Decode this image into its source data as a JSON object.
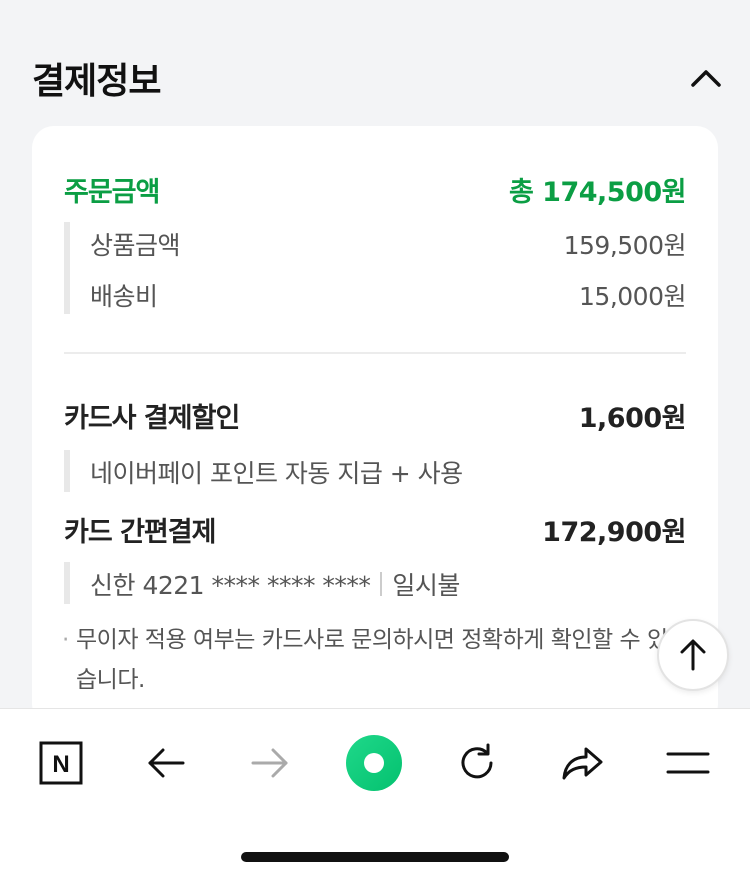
{
  "section": {
    "title": "결제정보"
  },
  "order": {
    "label": "주문금액",
    "total": "총 174,500원",
    "items": [
      {
        "label": "상품금액",
        "value": "159,500원"
      },
      {
        "label": "배송비",
        "value": "15,000원"
      }
    ]
  },
  "discount": {
    "label": "카드사 결제할인",
    "value": "1,600원",
    "detail": "네이버페이 포인트 자동 지급 + 사용"
  },
  "payment": {
    "label": "카드 간편결제",
    "value": "172,900원",
    "card": "신한 4221 **** **** ****",
    "installment": "일시불"
  },
  "notice": {
    "bullet": "·",
    "text": "무이자 적용 여부는 카드사로 문의하시면 정확하게 확인할 수 있습니다."
  },
  "bottom_nav": {
    "n_logo": "N"
  },
  "colors": {
    "accent_green": "#0b9e44",
    "greendot_start": "#1fd88a",
    "greendot_end": "#04c16f"
  }
}
